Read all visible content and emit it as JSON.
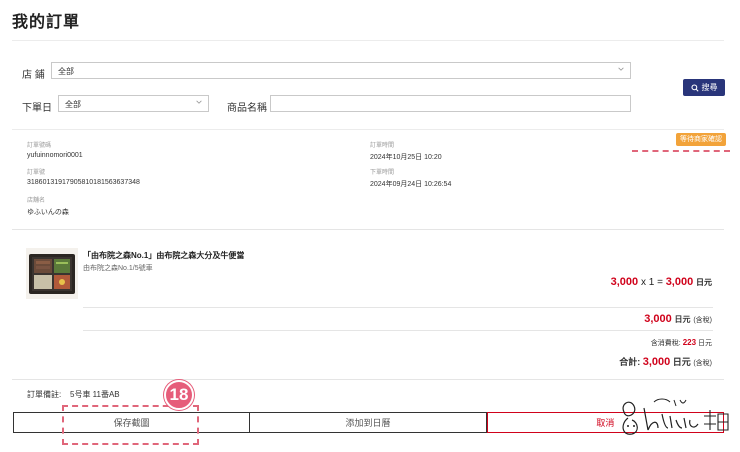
{
  "page": {
    "title": "我的訂單"
  },
  "filters": {
    "store_label": "店 鋪",
    "store_value": "全部",
    "date_label": "下單日",
    "date_value": "全部",
    "product_label": "商品名稱",
    "product_value": "",
    "search_label": "搜尋"
  },
  "order": {
    "order_no_label": "訂單號碼",
    "order_no": "yufuinnomori0001",
    "order_time_label": "訂單時間",
    "order_time": "2024年10月25日 10:20",
    "order_id_label": "訂單號",
    "order_id": "3186013191790581018156363734​8",
    "place_time_label": "下單時間",
    "place_time": "2024年09月24日 10:26:54",
    "shop_label": "店舖名",
    "shop_name": "ゆふいんの森",
    "status": "等待商家確認"
  },
  "item": {
    "name": "「由布院之森No.1」由布院之森大分及牛便當",
    "sub": "由布院之森No.1/5號車",
    "price": "3,000",
    "times": "x",
    "qty": "1",
    "equals": "=",
    "subtotal": "3,000",
    "unit": "日元"
  },
  "totals": {
    "incl_amount": "3,000",
    "unit": "日元",
    "tax_note": "(含稅)",
    "tax_label": "含消費稅:",
    "tax_amount": "223",
    "sum_label": "合計:",
    "sum_amount": "3,000"
  },
  "note": {
    "label": "訂單備註:",
    "value": "5号車 11番AB"
  },
  "annotation": {
    "step": "18"
  },
  "actions": {
    "save": "保存截圖",
    "calendar": "添加到日曆",
    "cancel": "取消"
  },
  "colors": {
    "accent": "#29357a",
    "price_red": "#d0021b",
    "badge_orange": "#f2a33a",
    "marker_pink": "#e65d7a"
  }
}
